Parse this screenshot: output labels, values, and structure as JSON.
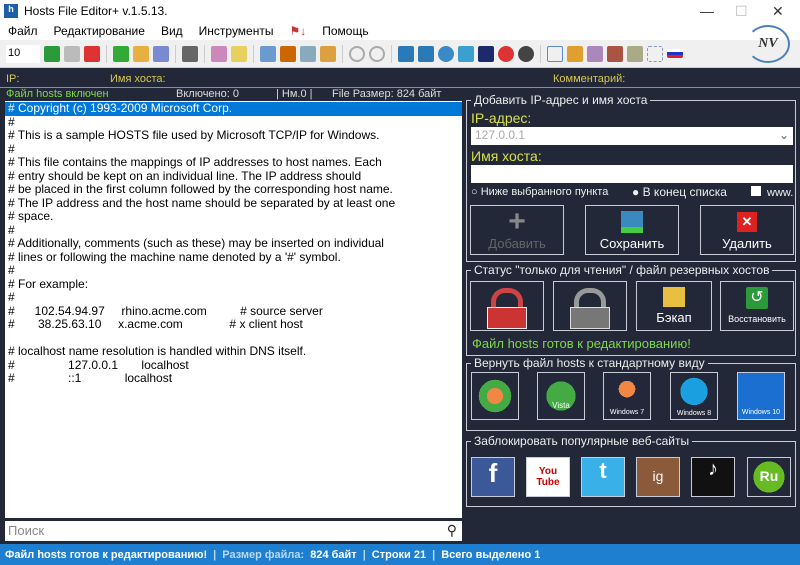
{
  "title": "Hosts File Editor+ v.1.5.13.",
  "menu": [
    "Файл",
    "Редактирование",
    "Вид",
    "Инструменты",
    "Помощь"
  ],
  "font_size": "10",
  "header": {
    "ip": "IP:",
    "host": "Имя хоста:",
    "comment": "Комментарий:"
  },
  "stat": {
    "enabled": "Файл hosts включен",
    "included": "Включено: 0",
    "nm": "| Нм.0 |",
    "size": "File Размер: 824 байт"
  },
  "lines": [
    "# Copyright (c) 1993-2009 Microsoft Corp.",
    "#",
    "# This is a sample HOSTS file used by Microsoft TCP/IP for Windows.",
    "#",
    "# This file contains the mappings of IP addresses to host names. Each",
    "# entry should be kept on an individual line. The IP address should",
    "# be placed in the first column followed by the corresponding host name.",
    "# The IP address and the host name should be separated by at least one",
    "# space.",
    "#",
    "# Additionally, comments (such as these) may be inserted on individual",
    "# lines or following the machine name denoted by a '#' symbol.",
    "#",
    "# For example:",
    "#",
    "#      102.54.94.97     rhino.acme.com          # source server",
    "#       38.25.63.10     x.acme.com              # x client host",
    "",
    "# localhost name resolution is handled within DNS itself.",
    "#                127.0.0.1       localhost",
    "#                ::1             localhost"
  ],
  "search_placeholder": "Поиск",
  "add": {
    "legend": "Добавить IP-адрес и имя хоста",
    "ip_label": "IP-адрес:",
    "ip_value": "127.0.0.1",
    "host_label": "Имя хоста:",
    "radio1": "Ниже выбранного пункта",
    "radio2": "В конец списка",
    "www": "www.",
    "add": "Добавить",
    "save": "Сохранить",
    "delete": "Удалить"
  },
  "ro": {
    "legend": "Статус \"только для чтения\" / файл резервных хостов",
    "backup": "Бэкап",
    "restore": "Восстановить",
    "message": "Файл hosts готов к редактированию!"
  },
  "restore": {
    "legend": "Вернуть файл hosts к стандартному виду",
    "items": [
      "XP",
      "Vista",
      "Windows 7",
      "Windows 8",
      "Windows 10"
    ]
  },
  "block": {
    "legend": "Заблокировать популярные веб-сайты",
    "items": [
      "f",
      "You Tube",
      "t",
      "ig",
      "tiktok",
      "Ru"
    ]
  },
  "statusbar": {
    "msg": "Файл hosts готов к редактированию!",
    "size_label": "Размер файла:",
    "size": "824 байт",
    "lines": "Строки 21",
    "selected": "Всего выделено 1"
  }
}
